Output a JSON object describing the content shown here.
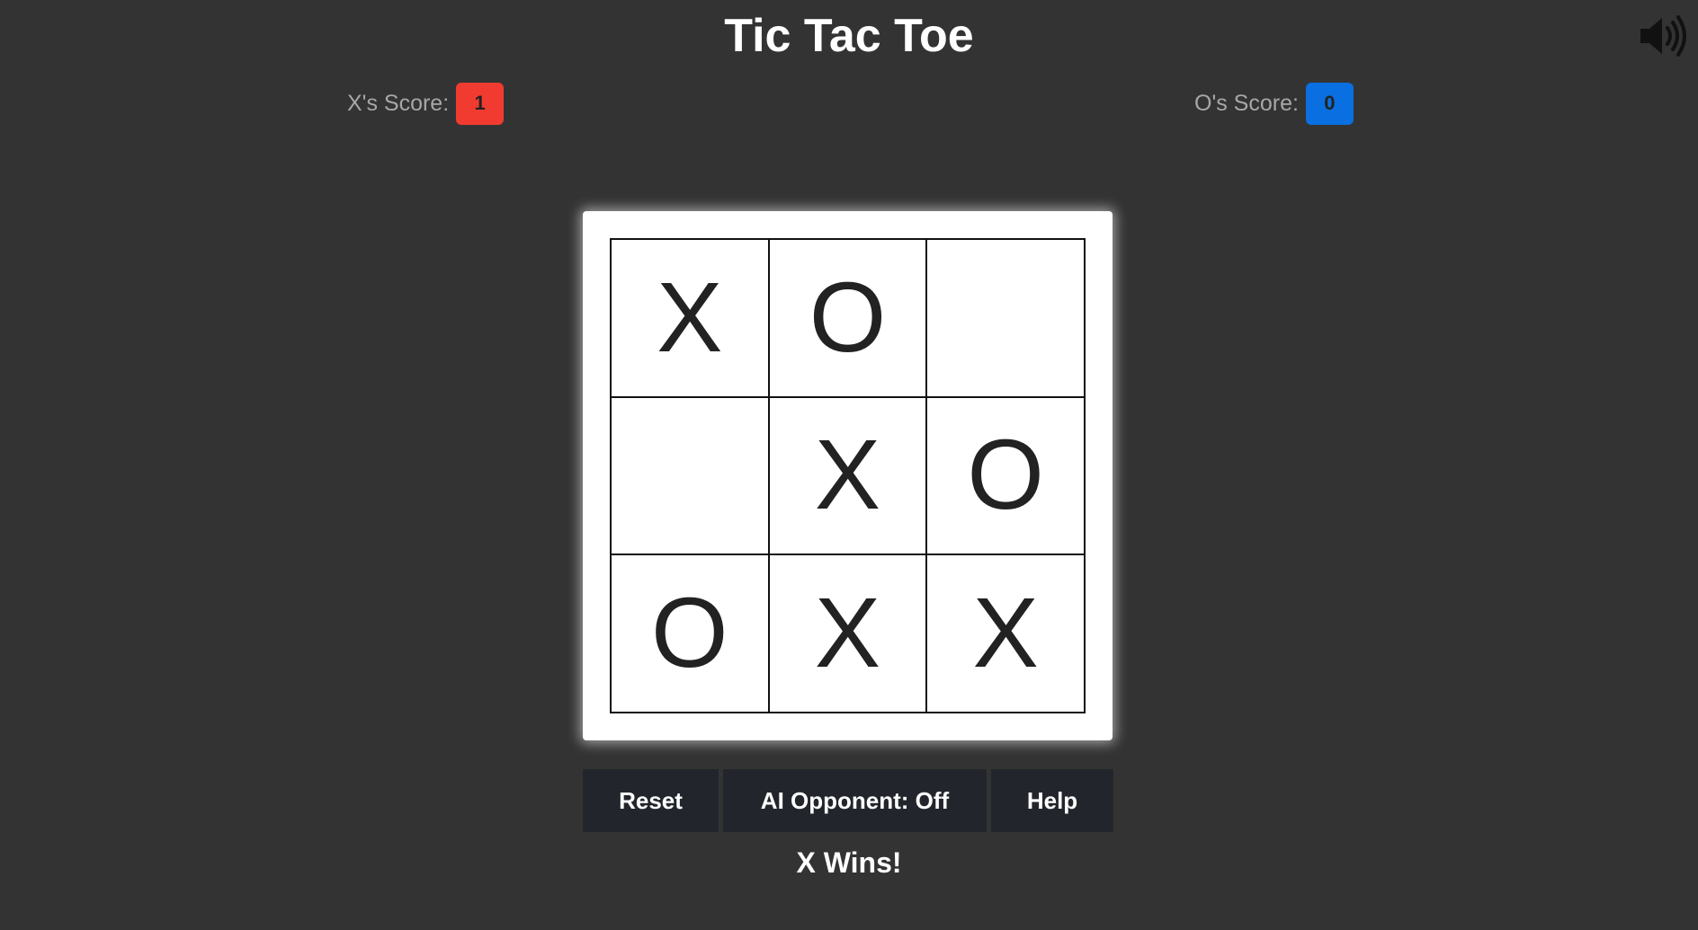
{
  "app": {
    "title": "Tic Tac Toe"
  },
  "sound": {
    "icon": "speaker-volume-icon"
  },
  "scores": {
    "x_label": "X's Score:",
    "x_value": "1",
    "x_color": "#f23b30",
    "o_label": "O's Score:",
    "o_value": "0",
    "o_color": "#0a6fe0"
  },
  "board": {
    "cells": [
      "X",
      "O",
      "",
      "",
      "X",
      "O",
      "O",
      "X",
      "X"
    ]
  },
  "controls": {
    "reset_label": "Reset",
    "ai_label": "AI Opponent: Off",
    "help_label": "Help"
  },
  "status": {
    "message": "X Wins!"
  }
}
